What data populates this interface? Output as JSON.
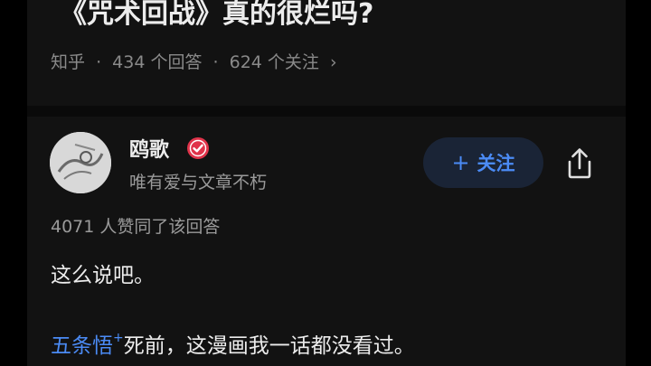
{
  "question": {
    "title": "《咒术回战》真的很烂吗?",
    "meta": {
      "source": "知乎",
      "separator": "·",
      "answers": "434 个回答",
      "followers": "624 个关注",
      "chevron": "›"
    }
  },
  "answer": {
    "author": {
      "name": "鸥歌",
      "bio": "唯有爱与文章不朽",
      "badge_icon": "verified-badge-icon",
      "avatar_icon": "avatar-image"
    },
    "follow_label": "关注",
    "follow_icon": "plus-icon",
    "share_icon": "share-icon",
    "upvote_text": "4071 人赞同了该回答",
    "paragraphs": {
      "p1": "这么说吧。",
      "p2_link": "五条悟",
      "p2_link_sup": "+",
      "p2_rest": "死前，这漫画我一话都没看过。"
    }
  },
  "colors": {
    "accent": "#4b8bf5",
    "background": "#121212",
    "badge": "#e0334a",
    "text_primary": "#ececec",
    "text_secondary": "#9a9a9a"
  }
}
